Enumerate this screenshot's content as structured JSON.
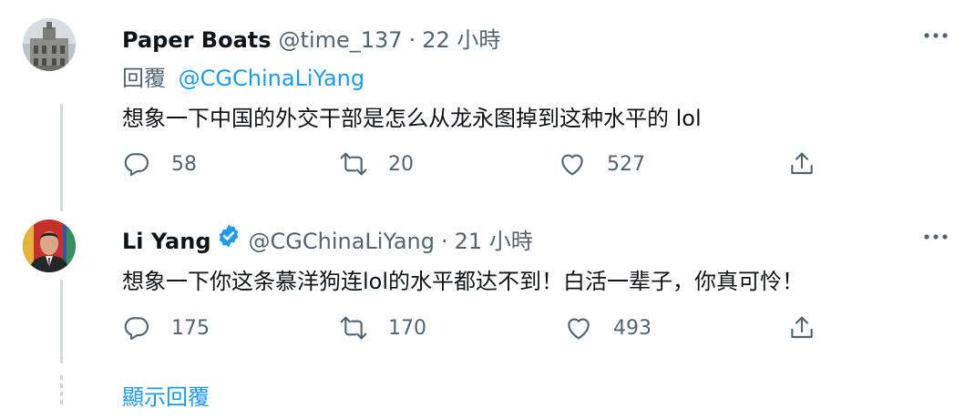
{
  "tweets": [
    {
      "name": "Paper Boats",
      "handle": "@time_137",
      "separator": "·",
      "time": "22 小時",
      "reply_label": "回覆",
      "reply_mention": "@CGChinaLiYang",
      "text": "想象一下中国的外交干部是怎么从龙永图掉到这种水平的 lol",
      "counts": {
        "replies": "58",
        "retweets": "20",
        "likes": "527"
      },
      "avatar_icon": "building-photo-avatar",
      "verified": false
    },
    {
      "name": "Li Yang",
      "handle": "@CGChinaLiYang",
      "separator": "·",
      "time": "21 小時",
      "text": "想象一下你这条慕洋狗连lol的水平都达不到！白活一辈子，你真可怜！",
      "counts": {
        "replies": "175",
        "retweets": "170",
        "likes": "493"
      },
      "avatar_icon": "portrait-photo-avatar",
      "verified": true
    }
  ],
  "show_replies_label": "顯示回覆",
  "colors": {
    "accent": "#1d9bf0",
    "secondary_text": "#536471",
    "primary_text": "#0f1419",
    "thread_line": "#cfd9de"
  }
}
